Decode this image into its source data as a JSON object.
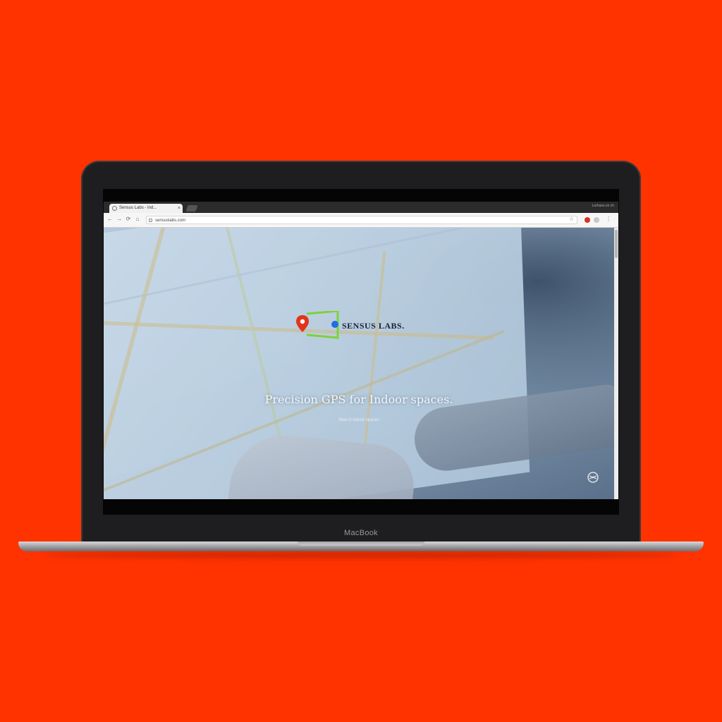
{
  "device": {
    "brand_label": "MacBook"
  },
  "browser": {
    "tab_title": "Sensus Labs - Ind...",
    "tab_close": "×",
    "window_user": "Lorhaos.ve ch",
    "address": "sensuslabs.com",
    "nav_back": "←",
    "nav_forward": "→",
    "nav_reload": "⟳",
    "nav_home": "⌂",
    "star": "☆",
    "menu": "⋮"
  },
  "page": {
    "logo_text": "SENSUS LABS.",
    "hero_title": "Precision GPS for Indoor spaces.",
    "hero_subtitle": "Now in indoor spaces"
  },
  "colors": {
    "background": "#ff3300",
    "pin": "#e2341c",
    "bracket": "#7bd33a",
    "dot": "#1f6fe0"
  },
  "icons": {
    "pin": "map-pin-icon",
    "badge": "globe-icon"
  }
}
